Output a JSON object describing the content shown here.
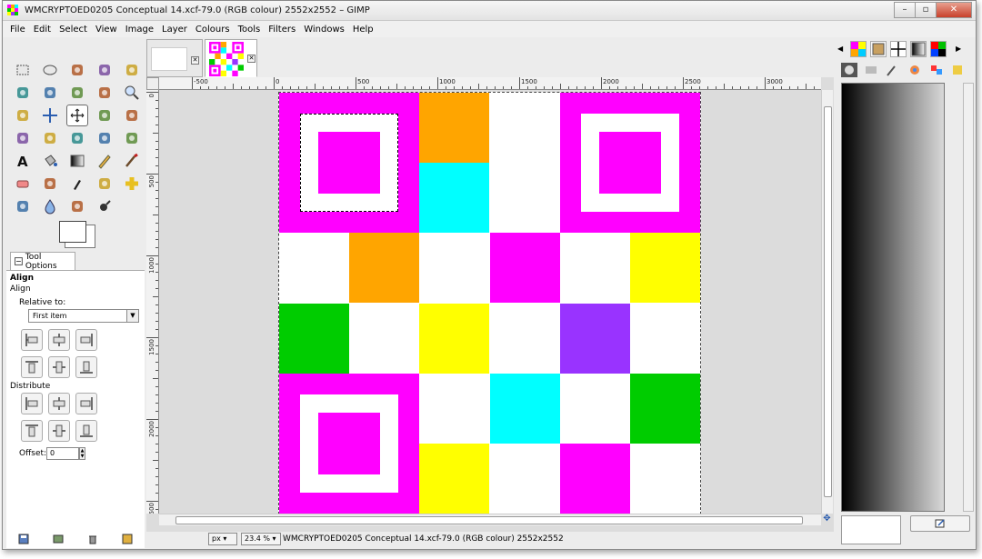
{
  "window": {
    "title": "WMCRYPTOED0205 Conceptual 14.xcf-79.0 (RGB colour) 2552x2552 – GIMP",
    "minimize": "–",
    "maximize": "▫",
    "close": "✕"
  },
  "menu": [
    "File",
    "Edit",
    "Select",
    "View",
    "Image",
    "Layer",
    "Colours",
    "Tools",
    "Filters",
    "Windows",
    "Help"
  ],
  "tool_options": {
    "tab_label": "Tool Options",
    "tool_name": "Align",
    "section_align": "Align",
    "relative_to_label": "Relative to:",
    "relative_to_value": "First item",
    "section_distribute": "Distribute",
    "offset_label": "Offset:",
    "offset_value": "0"
  },
  "rulers": {
    "horizontal": [
      "-500",
      "0",
      "500",
      "1000",
      "1500",
      "2000",
      "2500",
      "3000"
    ],
    "vertical": [
      "0",
      "500",
      "1000",
      "1500",
      "2000",
      "2500"
    ]
  },
  "status": {
    "unit": "px",
    "zoom": "23.4 %",
    "text": "WMCRYPTOED0205 Conceptual 14.xcf-79.0 (RGB colour) 2552x2552"
  },
  "image": {
    "grid_size": 6,
    "cells": [
      {
        "row": 0,
        "col": 2,
        "color": "#ffa500"
      },
      {
        "row": 1,
        "col": 2,
        "color": "#00ffff"
      },
      {
        "row": 2,
        "col": 1,
        "color": "#ffa500"
      },
      {
        "row": 2,
        "col": 3,
        "color": "#ff00ff"
      },
      {
        "row": 2,
        "col": 5,
        "color": "#ffff00"
      },
      {
        "row": 3,
        "col": 0,
        "color": "#00cc00"
      },
      {
        "row": 3,
        "col": 2,
        "color": "#ffff00"
      },
      {
        "row": 3,
        "col": 4,
        "color": "#9933ff"
      },
      {
        "row": 4,
        "col": 3,
        "color": "#00ffff"
      },
      {
        "row": 4,
        "col": 5,
        "color": "#00cc00"
      },
      {
        "row": 5,
        "col": 2,
        "color": "#ffff00"
      },
      {
        "row": 5,
        "col": 4,
        "color": "#ff00ff"
      }
    ],
    "finder_color": "#ff00ff"
  },
  "colors": {
    "foreground": "#000000",
    "background": "#ffffff"
  },
  "tools": [
    "rect-select-icon",
    "ellipse-select-icon",
    "lasso-icon",
    "fuzzy-select-icon",
    "color-select-icon",
    "scissors-icon",
    "foreground-select-icon",
    "paths-icon",
    "color-picker-icon",
    "zoom-icon",
    "measure-icon",
    "move-icon",
    "align-icon",
    "crop-icon",
    "rotate-icon",
    "scale-icon",
    "shear-icon",
    "perspective-icon",
    "flip-icon",
    "cage-icon",
    "text-icon",
    "bucket-fill-icon",
    "blend-icon",
    "pencil-icon",
    "paintbrush-icon",
    "eraser-icon",
    "airbrush-icon",
    "ink-icon",
    "clone-icon",
    "heal-icon",
    "perspective-clone-icon",
    "blur-icon",
    "smudge-icon",
    "dodge-burn-icon"
  ]
}
